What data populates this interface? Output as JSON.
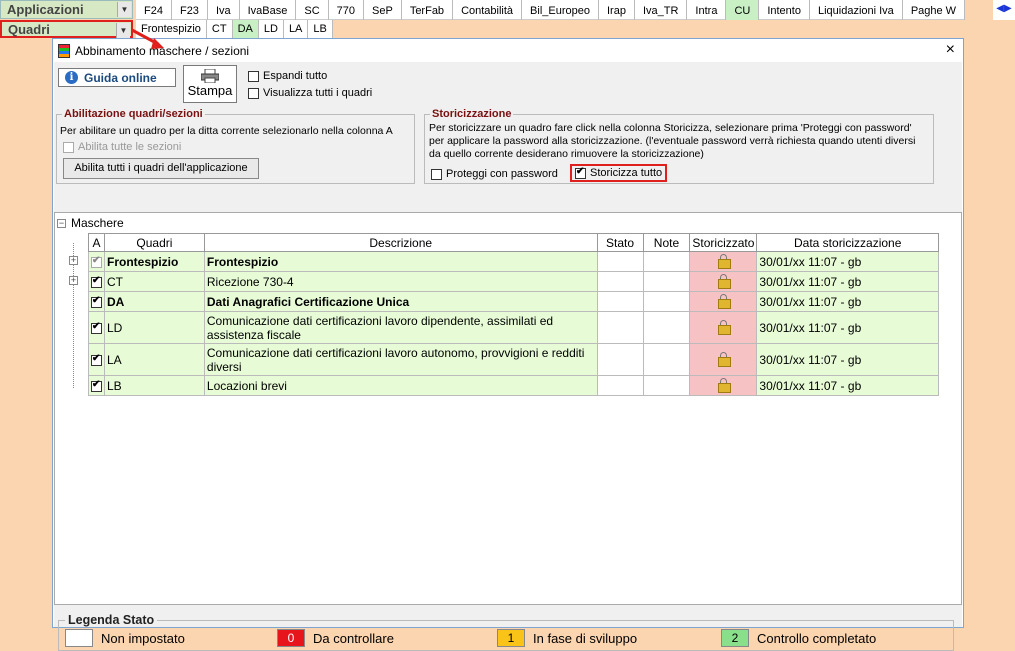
{
  "toolbar": {
    "app_select": "Applicazioni",
    "quadri_select": "Quadri",
    "tabs": [
      "F24",
      "F23",
      "Iva",
      "IvaBase",
      "SC",
      "770",
      "SeP",
      "TerFab",
      "Contabilità",
      "Bil_Europeo",
      "Irap",
      "Iva_TR",
      "Intra",
      "CU",
      "Intento",
      "Liquidazioni Iva",
      "Paghe W"
    ],
    "active_tab": "CU",
    "subtabs": [
      "Frontespizio",
      "CT",
      "DA",
      "LD",
      "LA",
      "LB"
    ],
    "active_subtab": "DA"
  },
  "dialog": {
    "title": "Abbinamento maschere / sezioni",
    "close": "×",
    "guida_label": "Guida online",
    "stampa_label": "Stampa",
    "espandi_label": "Espandi tutto",
    "visualizza_label": "Visualizza tutti i quadri",
    "abilitazione": {
      "title": "Abilitazione quadri/sezioni",
      "text": "Per abilitare un quadro per la ditta corrente selezionarlo nella colonna A",
      "abilita_sezioni": "Abilita tutte le sezioni",
      "abilita_button": "Abilita tutti i quadri dell'applicazione"
    },
    "storicizzazione": {
      "title": "Storicizzazione",
      "text": "Per storicizzare un quadro fare click nella colonna Storicizza, selezionare prima 'Proteggi con password' per applicare la password alla storicizzazione. (l'eventuale password verrà richiesta quando utenti diversi da quello corrente desiderano rimuovere la storicizzazione)",
      "proteggi_label": "Proteggi con password",
      "storicizza_label": "Storicizza tutto"
    },
    "tree_root": "Maschere",
    "columns": [
      "A",
      "Quadri",
      "Descrizione",
      "Stato",
      "Note",
      "Storicizzato",
      "Data storicizzazione"
    ],
    "rows": [
      {
        "quadro": "Frontespizio",
        "descrizione": "Frontespizio",
        "data": "30/01/xx 11:07 - gb"
      },
      {
        "quadro": "CT",
        "descrizione": "Ricezione 730-4",
        "data": "30/01/xx 11:07 - gb"
      },
      {
        "quadro": "DA",
        "descrizione": "Dati Anagrafici Certificazione Unica",
        "data": "30/01/xx 11:07 - gb"
      },
      {
        "quadro": "LD",
        "descrizione": "Comunicazione dati certificazioni  lavoro dipendente, assimilati ed assistenza fiscale",
        "data": "30/01/xx 11:07 - gb"
      },
      {
        "quadro": "LA",
        "descrizione": "Comunicazione dati certificazioni lavoro autonomo, provvigioni e redditi diversi",
        "data": "30/01/xx 11:07 - gb"
      },
      {
        "quadro": "LB",
        "descrizione": "Locazioni brevi",
        "data": "30/01/xx 11:07 - gb"
      }
    ],
    "legend": {
      "title": "Legenda Stato",
      "items": [
        {
          "code": "",
          "label": "Non impostato",
          "color": "#ffffff"
        },
        {
          "code": "0",
          "label": "Da controllare",
          "color": "#e8141c"
        },
        {
          "code": "1",
          "label": "In fase di sviluppo",
          "color": "#f9c318"
        },
        {
          "code": "2",
          "label": "Controllo completato",
          "color": "#8ae08a"
        }
      ]
    }
  }
}
